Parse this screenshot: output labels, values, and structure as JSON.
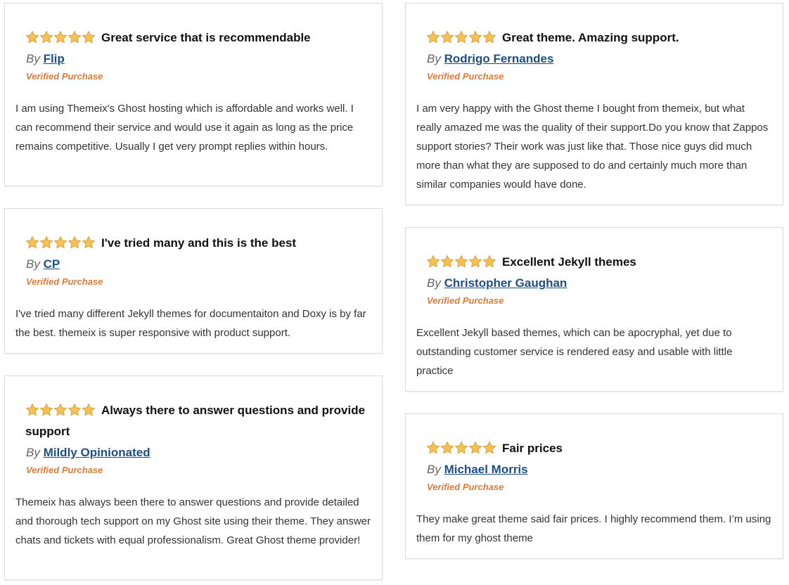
{
  "by_label": "By",
  "verified_label": "Verified Purchase",
  "colors": {
    "star_fill": "#f5c156",
    "star_stroke": "#d9a43a",
    "author_link": "#1e4e86",
    "verified": "#e07b39"
  },
  "reviews": [
    {
      "rating": 5,
      "title": "Great service that is recommendable",
      "author": "Flip",
      "text": "I am using Themeix's Ghost hosting which is affordable and works well. I can recommend their service and would use it again as long as the price remains competitive. Usually I get very prompt replies within hours."
    },
    {
      "rating": 5,
      "title": "I've tried many and this is the best",
      "author": "CP",
      "text": "I've tried many different Jekyll themes for documentaiton and Doxy is by far the best. themeix is super responsive with product support."
    },
    {
      "rating": 5,
      "title": "Always there to answer questions and provide support",
      "author": "Mildly Opinionated",
      "text": "Themeix has always been there to answer questions and provide detailed and thorough tech support on my Ghost site using their theme. They answer chats and tickets with equal professionalism. Great Ghost theme provider!"
    },
    {
      "rating": 5,
      "title": "Great theme. Amazing support.",
      "author": "Rodrigo Fernandes",
      "text": "I am very happy with the Ghost theme I bought from themeix, but what really amazed me was the quality of their support.Do you know that Zappos support stories? Their work was just like that. Those nice guys did much more than what they are supposed to do and certainly much more than similar companies would have done."
    },
    {
      "rating": 5,
      "title": "Excellent Jekyll themes",
      "author": "Christopher Gaughan",
      "text": "Excellent Jekyll based themes, which can be apocryphal, yet due to outstanding customer service is rendered easy and usable with little practice"
    },
    {
      "rating": 5,
      "title": "Fair prices",
      "author": "Michael Morris",
      "text": "They make great theme said fair prices. I highly recommend them. I’m using them for my ghost theme"
    }
  ]
}
